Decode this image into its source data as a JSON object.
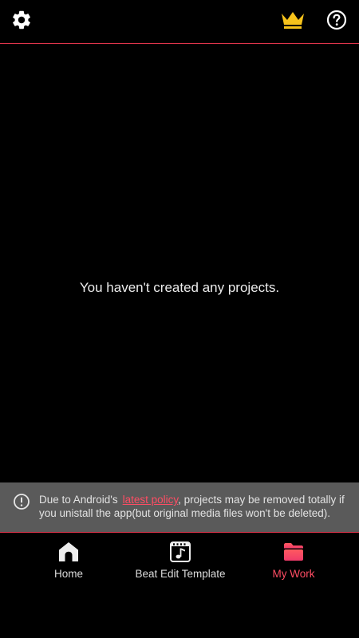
{
  "colors": {
    "accent": "#ff4d64",
    "divider": "#e0344b",
    "crown": "#f7c31b",
    "notice_bg": "#5a5a5a",
    "background": "#000000"
  },
  "header": {
    "icons": [
      "gear-icon",
      "crown-icon",
      "help-icon"
    ]
  },
  "main": {
    "empty_message": "You haven't created any projects."
  },
  "notice": {
    "icon": "info-icon",
    "prefix": "Due to Android's",
    "link_text": "latest policy",
    "suffix": ", projects may be removed totally if",
    "line2": "you unistall the app(but original media files won't be deleted)."
  },
  "nav": {
    "items": [
      {
        "label": "Home",
        "icon": "home-icon",
        "active": false
      },
      {
        "label": "Beat Edit Template",
        "icon": "music-frame-icon",
        "active": false
      },
      {
        "label": "My Work",
        "icon": "folder-icon",
        "active": true
      }
    ]
  }
}
